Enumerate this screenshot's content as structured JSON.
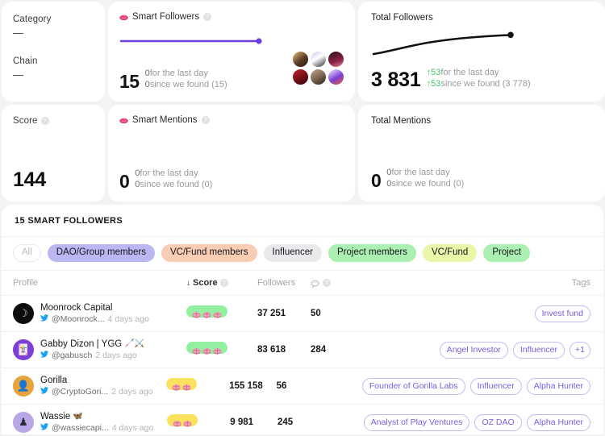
{
  "colors": {
    "accent_purple": "#7b5ce0",
    "spark_purple": "#6c3fe0",
    "positive_green": "#4cc76a",
    "score_green": "#93f0a1",
    "score_yellow": "#fbe15c",
    "page_bg": "#f2f3f5"
  },
  "meta_card": {
    "blocks": [
      {
        "label": "Category",
        "value": "—"
      },
      {
        "label": "Chain",
        "value": "—"
      }
    ]
  },
  "smart_followers_card": {
    "icon": "brain-icon",
    "title": "Smart Followers",
    "info_icon": "info-icon",
    "value": "15",
    "delta_day": {
      "value": "0",
      "suffix": "for the last day"
    },
    "delta_found": {
      "value": "0",
      "suffix": "since we found (15)"
    },
    "avatar_count": 6
  },
  "total_followers_card": {
    "title": "Total Followers",
    "value": "3 831",
    "delta_day": {
      "arrow": "↑",
      "value": "53",
      "suffix": "for the last day"
    },
    "delta_found": {
      "arrow": "↑",
      "value": "53",
      "suffix": "since we found (3 778)"
    },
    "chart_data": {
      "type": "line",
      "title": "Total Followers",
      "x": [
        0,
        1,
        2,
        3,
        4,
        5,
        6,
        7
      ],
      "values": [
        3700,
        3742,
        3766,
        3783,
        3798,
        3812,
        3824,
        3831
      ],
      "ylim": [
        3690,
        3840
      ],
      "grid": false,
      "legend": "none",
      "xlabel": "",
      "ylabel": ""
    }
  },
  "score_card": {
    "title": "Score",
    "info_icon": "info-icon",
    "value": "144"
  },
  "smart_mentions_card": {
    "icon": "brain-icon",
    "title": "Smart Mentions",
    "info_icon": "info-icon",
    "value": "0",
    "delta_day": {
      "value": "0",
      "suffix": "for the last day"
    },
    "delta_found": {
      "value": "0",
      "suffix": "since we found (0)"
    }
  },
  "total_mentions_card": {
    "title": "Total Mentions",
    "value": "0",
    "delta_day": {
      "value": "0",
      "suffix": "for the last day"
    },
    "delta_found": {
      "value": "0",
      "suffix": "since we found (0)"
    }
  },
  "panel": {
    "title": "15 SMART FOLLOWERS",
    "filters": [
      {
        "label": "All",
        "style": "all"
      },
      {
        "label": "DAO/Group members",
        "style": "dao"
      },
      {
        "label": "VC/Fund members",
        "style": "vcfund-members"
      },
      {
        "label": "Influencer",
        "style": "influencer"
      },
      {
        "label": "Project members",
        "style": "project-members"
      },
      {
        "label": "VC/Fund",
        "style": "vcfund"
      },
      {
        "label": "Project",
        "style": "project"
      }
    ],
    "columns": {
      "profile": "Profile",
      "score": "Score",
      "score_sort_arrow": "↓",
      "followers": "Followers",
      "mentions_icon": "smart-mentions-icon",
      "tags": "Tags"
    },
    "rows": [
      {
        "name": "Moonrock Capital",
        "name_emoji": "",
        "handle": "@Moonrock...",
        "ago": "4 days ago",
        "score_badge": {
          "tone": "green",
          "brains": 3
        },
        "followers": "37 251",
        "mentions": "50",
        "tags": [
          "Invest fund"
        ],
        "avatar": {
          "bg": "#0d0d0f",
          "glyph": "☽",
          "glyph_color": "#d8d8dd"
        }
      },
      {
        "name": "Gabby Dizon | YGG",
        "name_emoji": "🦯⚔️",
        "handle": "@gabusch",
        "ago": "2 days ago",
        "score_badge": {
          "tone": "green",
          "brains": 3
        },
        "followers": "83 618",
        "mentions": "284",
        "tags": [
          "Angel Investor",
          "Influencer",
          "+1"
        ],
        "avatar": {
          "bg": "#7b3fd6",
          "glyph": "🃏",
          "glyph_color": "#44d07a"
        }
      },
      {
        "name": "Gorilla",
        "name_emoji": "",
        "handle": "@CryptoGori...",
        "ago": "2 days ago",
        "score_badge": {
          "tone": "yellow",
          "brains": 2
        },
        "followers": "155 158",
        "mentions": "56",
        "tags": [
          "Founder of Gorilla Labs",
          "Influencer",
          "Alpha Hunter"
        ],
        "avatar": {
          "bg": "#e8a33d",
          "glyph": "👤",
          "glyph_color": "#f3e0c4"
        }
      },
      {
        "name": "Wassie",
        "name_emoji": "🦋",
        "handle": "@wassiecapi...",
        "ago": "4 days ago",
        "score_badge": {
          "tone": "yellow",
          "brains": 2
        },
        "followers": "9 981",
        "mentions": "245",
        "tags": [
          "Analyst of Play Ventures",
          "OZ DAO",
          "Alpha Hunter"
        ],
        "avatar": {
          "bg": "#b9a6e8",
          "glyph": "♟",
          "glyph_color": "#2b2b33"
        }
      }
    ]
  }
}
